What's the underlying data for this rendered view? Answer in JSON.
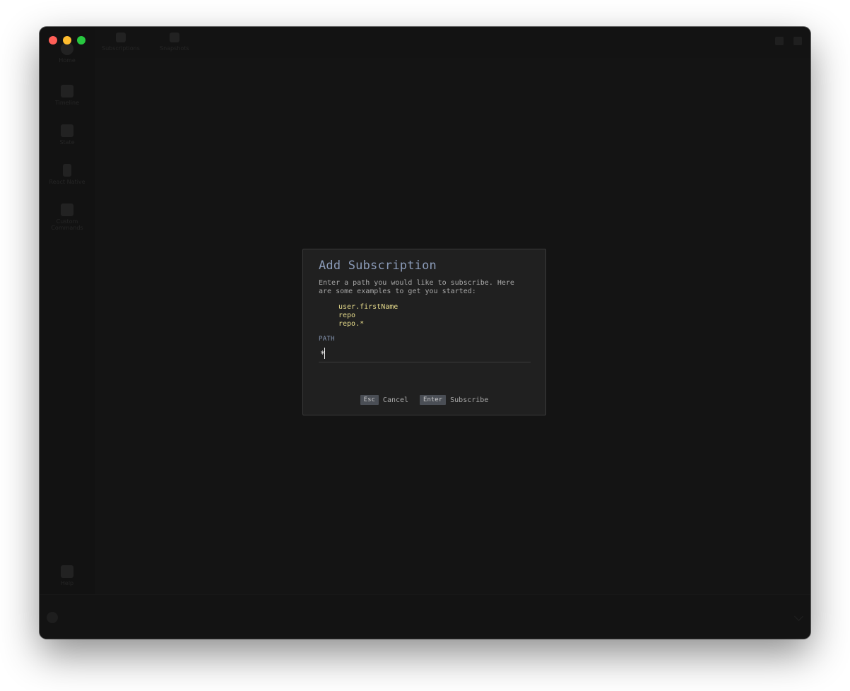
{
  "window": {
    "traffic_lights": [
      "close",
      "minimize",
      "zoom"
    ]
  },
  "sidebar": {
    "items": [
      {
        "label": "Home",
        "icon": "home-icon"
      },
      {
        "label": "Timeline",
        "icon": "list-icon"
      },
      {
        "label": "State",
        "icon": "clipboard-icon"
      },
      {
        "label": "React Native",
        "icon": "phone-icon"
      },
      {
        "label": "Custom Commands",
        "icon": "pen-icon"
      },
      {
        "label": "Help",
        "icon": "help-icon"
      }
    ]
  },
  "topbar": {
    "tabs": [
      {
        "label": "Subscriptions",
        "icon": "bell-icon"
      },
      {
        "label": "Snapshots",
        "icon": "snapshot-icon"
      }
    ]
  },
  "modal": {
    "title": "Add Subscription",
    "description": "Enter a path you would like to subscribe. Here are some examples to get you started:",
    "examples": [
      "user.firstName",
      "repo",
      "repo.*"
    ],
    "path_label": "PATH",
    "path_value": "*",
    "cancel_key": "Esc",
    "cancel_label": "Cancel",
    "submit_key": "Enter",
    "submit_label": "Subscribe"
  },
  "colors": {
    "title": "#8b9bb8",
    "example_text": "#e7dc8c",
    "modal_bg": "#202020",
    "app_bg": "#141414"
  }
}
